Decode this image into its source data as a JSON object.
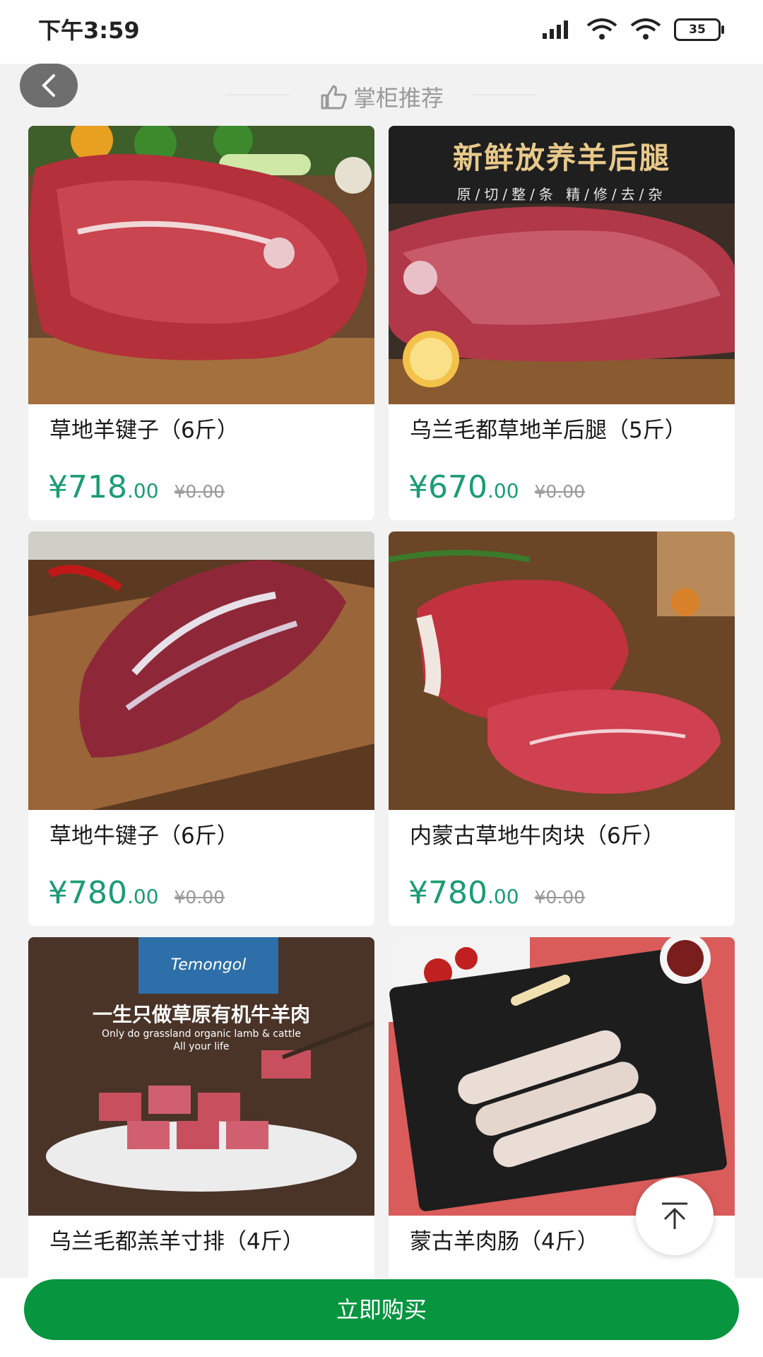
{
  "status_bar": {
    "time": "下午3:59",
    "battery": "35"
  },
  "header": {
    "title": "掌柜推荐",
    "back_icon": "chevron-left-icon",
    "title_icon": "thumbs-up-icon"
  },
  "products": [
    {
      "title": "草地羊键子（6斤）",
      "price_int": "¥718",
      "price_dec": ".00",
      "price_old": "¥0.00"
    },
    {
      "title": "乌兰毛都草地羊后腿（5斤）",
      "price_int": "¥670",
      "price_dec": ".00",
      "price_old": "¥0.00",
      "image_text": {
        "headline": "新鲜放养羊后腿",
        "sub": "原/切/整/条 精/修/去/杂"
      }
    },
    {
      "title": "草地牛键子（6斤）",
      "price_int": "¥780",
      "price_dec": ".00",
      "price_old": "¥0.00"
    },
    {
      "title": "内蒙古草地牛肉块（6斤）",
      "price_int": "¥780",
      "price_dec": ".00",
      "price_old": "¥0.00"
    },
    {
      "title": "乌兰毛都羔羊寸排（4斤）",
      "image_text": {
        "badge": "Temongol",
        "headline": "一生只做草原有机牛羊肉",
        "sub1": "Only do grassland organic lamb & cattle",
        "sub2": "All your life"
      }
    },
    {
      "title": "蒙古羊肉肠（4斤）"
    }
  ],
  "buy_button": {
    "label": "立即购买"
  },
  "scroll_top_icon": "arrow-up-icon"
}
